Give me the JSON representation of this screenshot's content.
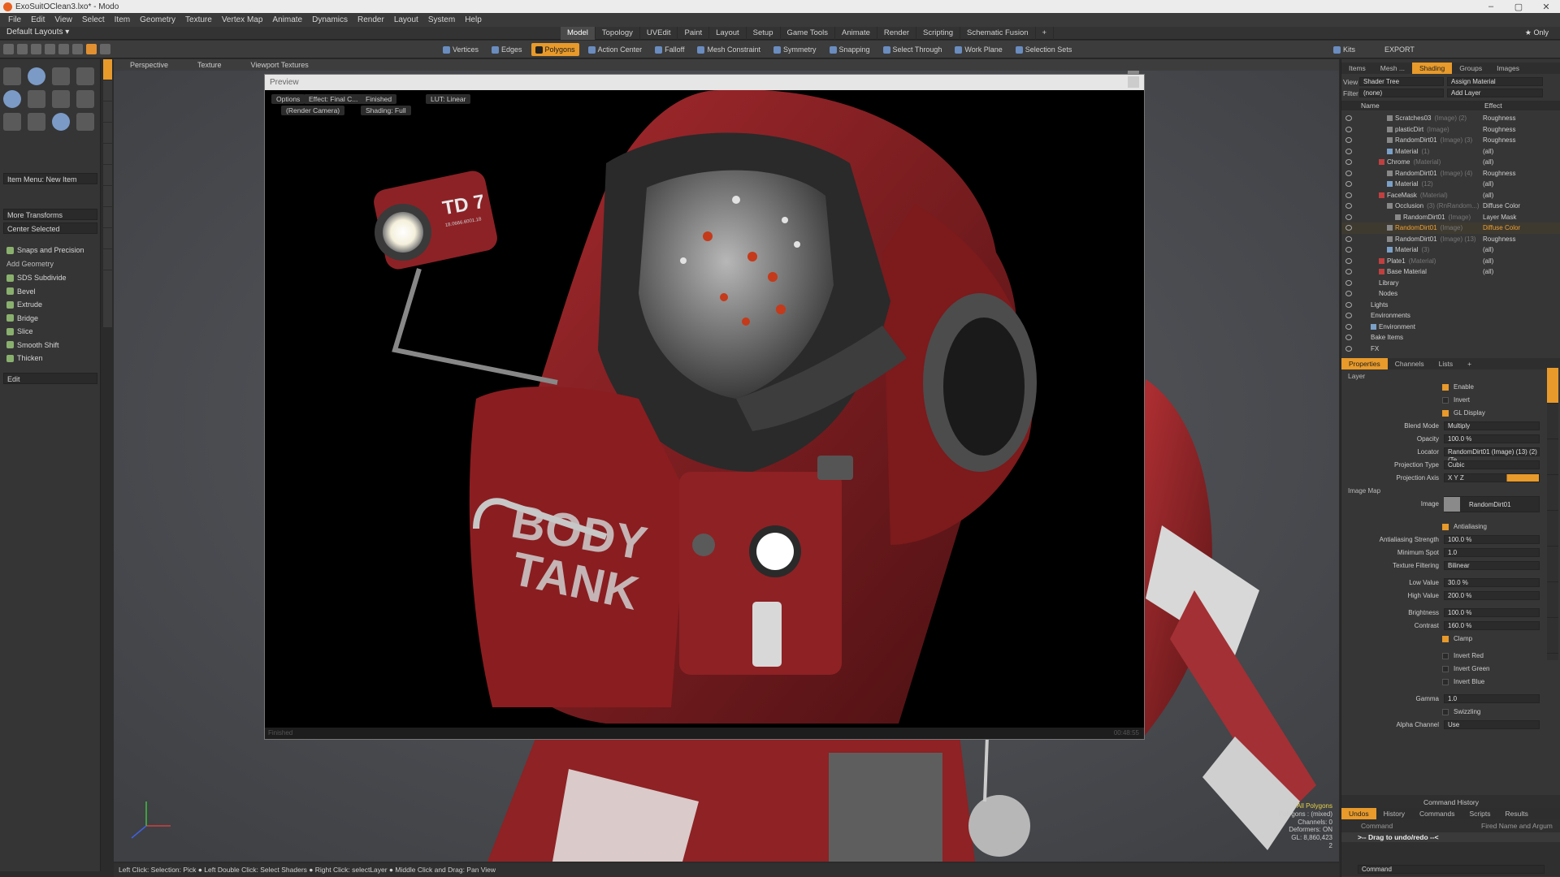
{
  "window": {
    "title": "ExoSuitOClean3.lxo* - Modo",
    "controls": [
      "–",
      "▢",
      "✕"
    ]
  },
  "menu": [
    "File",
    "Edit",
    "View",
    "Select",
    "Item",
    "Geometry",
    "Texture",
    "Vertex Map",
    "Animate",
    "Dynamics",
    "Render",
    "Layout",
    "System",
    "Help"
  ],
  "layout": {
    "label": "Default Layouts ▾"
  },
  "tabs": [
    {
      "label": "Model",
      "active": true
    },
    {
      "label": "Topology"
    },
    {
      "label": "UVEdit"
    },
    {
      "label": "Paint"
    },
    {
      "label": "Layout"
    },
    {
      "label": "Setup"
    },
    {
      "label": "Game Tools"
    },
    {
      "label": "Animate"
    },
    {
      "label": "Render"
    },
    {
      "label": "Scripting"
    },
    {
      "label": "Schematic Fusion"
    },
    {
      "label": "+"
    }
  ],
  "tab_right": "★ Only",
  "toolbar": {
    "items": [
      "Vertices",
      "Edges",
      "Polygons",
      "Action Center",
      "Falloff",
      "Mesh Constraint",
      "Symmetry",
      "Snapping",
      "Select Through",
      "Work Plane",
      "Selection Sets"
    ],
    "active": "Polygons",
    "right": [
      "Kits",
      "EXPORT"
    ]
  },
  "left_panel": {
    "item_menu": "Item Menu: New Item",
    "more_transforms": "More Transforms",
    "center_selected": "Center Selected",
    "snaps": "Snaps and Precision",
    "add_geometry": "Add Geometry",
    "tools": [
      "SDS Subdivide",
      "Bevel",
      "Extrude",
      "Bridge",
      "Slice",
      "Smooth Shift",
      "Thicken"
    ],
    "edit": "Edit"
  },
  "viewport": {
    "tabs": [
      "Perspective",
      "Texture",
      "Viewport Textures"
    ],
    "info": [
      "All Polygons",
      "Polygons : (mixed)",
      "Channels: 0",
      "Deformers: ON",
      "GL: 8,860,423",
      "2"
    ]
  },
  "preview": {
    "title": "Preview",
    "buttons": [
      "Options",
      "Effect: Final C...",
      "Finished",
      "LUT: Linear",
      "(Render Camera)",
      "Shading: Full"
    ],
    "footer": "Finished",
    "footer_right": "00:48:55",
    "decal_text": "TD 7",
    "decal_sub": "18.0666.6001.18",
    "chest_text": [
      "BODY",
      "TANK"
    ]
  },
  "status": "Left Click: Selection: Pick ● Left Double Click: Select Shaders ● Right Click: selectLayer ● Middle Click and Drag: Pan View",
  "right_panel": {
    "tabs": [
      "Items",
      "Mesh ...",
      "Shading",
      "Groups",
      "Images"
    ],
    "active_tab": "Shading",
    "view_label": "View",
    "view_value": "Shader Tree",
    "assign": "Assign Material",
    "filter_label": "Filter",
    "filter_value": "(none)",
    "add_layer": "Add Layer",
    "col_name": "Name",
    "col_effect": "Effect",
    "shader_rows": [
      {
        "name": "Scratches03",
        "extra": "(Image) (2)",
        "effect": "Roughness",
        "indent": 3,
        "color": "#888"
      },
      {
        "name": "plasticDirt",
        "extra": "(Image)",
        "effect": "Roughness",
        "indent": 3,
        "color": "#888"
      },
      {
        "name": "RandomDirt01",
        "extra": "(Image) (3)",
        "effect": "Roughness",
        "indent": 3,
        "color": "#888"
      },
      {
        "name": "Material",
        "extra": "(1)",
        "effect": "(all)",
        "indent": 3,
        "color": "#7aa0c8"
      },
      {
        "name": "Chrome",
        "extra": "(Material)",
        "effect": "(all)",
        "indent": 2,
        "color": "#c04040"
      },
      {
        "name": "RandomDirt01",
        "extra": "(Image) (4)",
        "effect": "Roughness",
        "indent": 3,
        "color": "#888"
      },
      {
        "name": "Material",
        "extra": "(12)",
        "effect": "(all)",
        "indent": 3,
        "color": "#7aa0c8"
      },
      {
        "name": "FaceMask",
        "extra": "(Material)",
        "effect": "(all)",
        "indent": 2,
        "color": "#c04040"
      },
      {
        "name": "Occlusion",
        "extra": "(3) (RnRandom...)",
        "effect": "Diffuse Color",
        "indent": 3,
        "color": "#888"
      },
      {
        "name": "RandomDirt01",
        "extra": "(Image)",
        "effect": "Layer Mask",
        "indent": 4,
        "color": "#888"
      },
      {
        "name": "RandomDirt01",
        "extra": "(Image)",
        "effect": "Diffuse Color",
        "indent": 3,
        "color": "#888",
        "selected": true
      },
      {
        "name": "RandomDirt01",
        "extra": "(Image) (13)",
        "effect": "Roughness",
        "indent": 3,
        "color": "#888"
      },
      {
        "name": "Material",
        "extra": "(3)",
        "effect": "(all)",
        "indent": 3,
        "color": "#7aa0c8"
      },
      {
        "name": "Plate1",
        "extra": "(Material)",
        "effect": "(all)",
        "indent": 2,
        "color": "#c04040"
      },
      {
        "name": "Base Material",
        "extra": "",
        "effect": "(all)",
        "indent": 2,
        "color": "#c04040"
      },
      {
        "name": "Library",
        "extra": "",
        "effect": "",
        "indent": 1,
        "color": ""
      },
      {
        "name": "Nodes",
        "extra": "",
        "effect": "",
        "indent": 1,
        "color": ""
      },
      {
        "name": "Lights",
        "extra": "",
        "effect": "",
        "indent": 0,
        "color": ""
      },
      {
        "name": "Environments",
        "extra": "",
        "effect": "",
        "indent": 0,
        "color": ""
      },
      {
        "name": "Environment",
        "extra": "",
        "effect": "",
        "indent": 1,
        "color": "#7aa0c8"
      },
      {
        "name": "Bake Items",
        "extra": "",
        "effect": "",
        "indent": 0,
        "color": ""
      },
      {
        "name": "FX",
        "extra": "",
        "effect": "",
        "indent": 0,
        "color": ""
      }
    ],
    "prop_tabs": [
      "Properties",
      "Channels",
      "Lists",
      "+"
    ],
    "prop_active": "Properties",
    "section_layer": "Layer",
    "properties": [
      {
        "type": "check",
        "label": "Enable",
        "on": true
      },
      {
        "type": "check",
        "label": "Invert",
        "on": false
      },
      {
        "type": "check",
        "label": "GL Display",
        "on": true
      },
      {
        "type": "value",
        "label": "Blend Mode",
        "value": "Multiply"
      },
      {
        "type": "value",
        "label": "Opacity",
        "value": "100.0 %"
      },
      {
        "type": "value",
        "label": "Locator",
        "value": "RandomDirt01 (Image) (13) (2) (Te..."
      },
      {
        "type": "value",
        "label": "Projection Type",
        "value": "Cubic"
      },
      {
        "type": "axis",
        "label": "Projection Axis",
        "value": "X   Y   Z"
      },
      {
        "type": "section",
        "label": "Image Map"
      },
      {
        "type": "image",
        "label": "Image",
        "value": "RandomDirt01"
      },
      {
        "type": "check",
        "label": "Antialiasing",
        "on": true
      },
      {
        "type": "value",
        "label": "Antialiasing Strength",
        "value": "100.0 %"
      },
      {
        "type": "value",
        "label": "Minimum Spot",
        "value": "1.0"
      },
      {
        "type": "value",
        "label": "Texture Filtering",
        "value": "Bilinear"
      },
      {
        "type": "gap"
      },
      {
        "type": "value",
        "label": "Low Value",
        "value": "30.0 %"
      },
      {
        "type": "value",
        "label": "High Value",
        "value": "200.0 %"
      },
      {
        "type": "gap"
      },
      {
        "type": "value",
        "label": "Brightness",
        "value": "100.0 %"
      },
      {
        "type": "value",
        "label": "Contrast",
        "value": "160.0 %"
      },
      {
        "type": "check",
        "label": "Clamp",
        "on": true
      },
      {
        "type": "gap"
      },
      {
        "type": "check",
        "label": "Invert Red",
        "on": false
      },
      {
        "type": "check",
        "label": "Invert Green",
        "on": false
      },
      {
        "type": "check",
        "label": "Invert Blue",
        "on": false
      },
      {
        "type": "gap"
      },
      {
        "type": "value",
        "label": "Gamma",
        "value": "1.0"
      },
      {
        "type": "check",
        "label": "Swizzling",
        "on": false
      },
      {
        "type": "value",
        "label": "Alpha Channel",
        "value": "Use"
      }
    ],
    "cmd_title": "Command History",
    "cmd_tabs": [
      "Undos",
      "History",
      "Commands",
      "Scripts",
      "Results"
    ],
    "cmd_active": "Undos",
    "cmd_col1": "Command",
    "cmd_col2": "Fired Name and Argum",
    "cmd_hint": ">-- Drag to undo/redo --<",
    "cmd_input": "Command"
  },
  "colors": {
    "accent": "#e89a2a",
    "suit_red": "#8c1d1f",
    "metal": "#6a6a6a"
  }
}
